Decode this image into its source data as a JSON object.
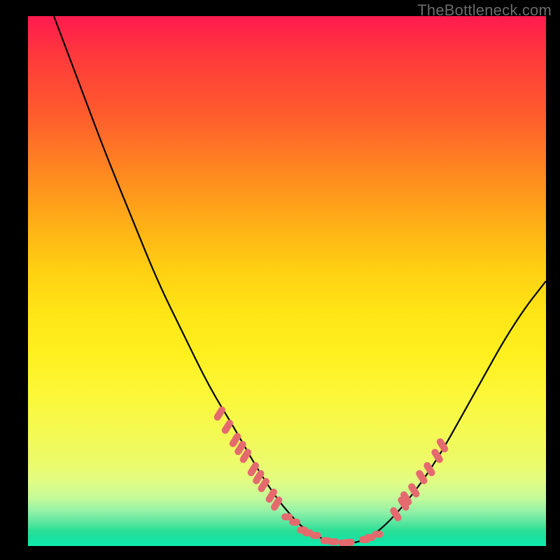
{
  "watermark": "TheBottleneck.com",
  "colors": {
    "background": "#000000",
    "gradient_top": "#ff1a4f",
    "gradient_bottom": "#0fefb0",
    "curve": "#000000",
    "markers": "#e56a6e"
  },
  "chart_data": {
    "type": "line",
    "title": "",
    "xlabel": "",
    "ylabel": "",
    "xlim": [
      0,
      100
    ],
    "ylim": [
      0,
      100
    ],
    "x": [
      5,
      10,
      15,
      20,
      25,
      30,
      35,
      40,
      44,
      48,
      51,
      53,
      55,
      57,
      59,
      61,
      63,
      65,
      68,
      72,
      76,
      80,
      84,
      88,
      92,
      96,
      100
    ],
    "values": [
      100,
      87,
      74,
      62,
      50,
      40,
      30,
      22,
      15,
      9,
      5.5,
      3.5,
      2.2,
      1.3,
      0.7,
      0.5,
      0.6,
      1.2,
      3,
      7,
      12,
      18,
      25,
      32,
      39,
      45,
      50
    ],
    "annotations": {
      "left_cluster_x": [
        37,
        38.5,
        40,
        41,
        42,
        43.5,
        44.5,
        45.5,
        47,
        48
      ],
      "left_cluster_y": [
        25,
        22.5,
        20,
        18.5,
        17,
        14.5,
        13,
        11.5,
        9.5,
        8
      ],
      "bottom_cluster_x": [
        50,
        51.5,
        53,
        54,
        55.5,
        57.5,
        59,
        61,
        62,
        65,
        66,
        67.5
      ],
      "bottom_cluster_y": [
        5.5,
        4.5,
        3,
        2.5,
        2,
        1,
        0.8,
        0.6,
        0.7,
        1.2,
        1.6,
        2.2
      ],
      "right_cluster_x": [
        71,
        72.5,
        73,
        74.5,
        76,
        77.5,
        79,
        80
      ],
      "right_cluster_y": [
        6,
        8,
        9,
        10.5,
        13,
        14.5,
        17,
        19
      ]
    }
  }
}
